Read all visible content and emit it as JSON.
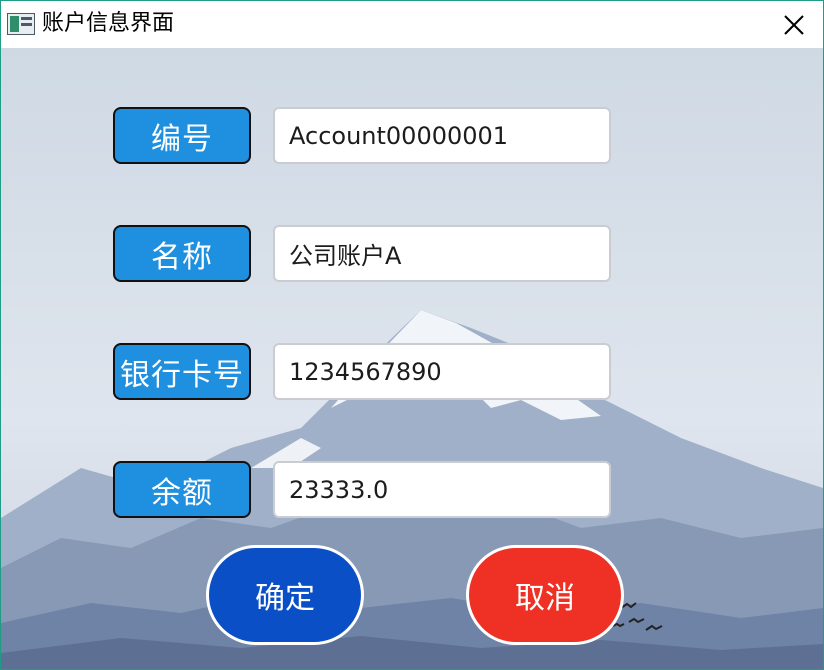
{
  "window": {
    "title": "账户信息界面"
  },
  "form": {
    "id_label": "编号",
    "id_value": "Account00000001",
    "name_label": "名称",
    "name_value": "公司账户A",
    "card_label": "银行卡号",
    "card_value": "1234567890",
    "balance_label": "余额",
    "balance_value": "23333.0"
  },
  "buttons": {
    "ok_label": "确定",
    "cancel_label": "取消"
  },
  "colors": {
    "label_bg": "#1f8fe0",
    "ok_button": "#0a4fc6",
    "cancel_button": "#ee3124",
    "window_border": "#1f9c86"
  },
  "icons": {
    "app": "app-icon",
    "close": "close-icon"
  }
}
